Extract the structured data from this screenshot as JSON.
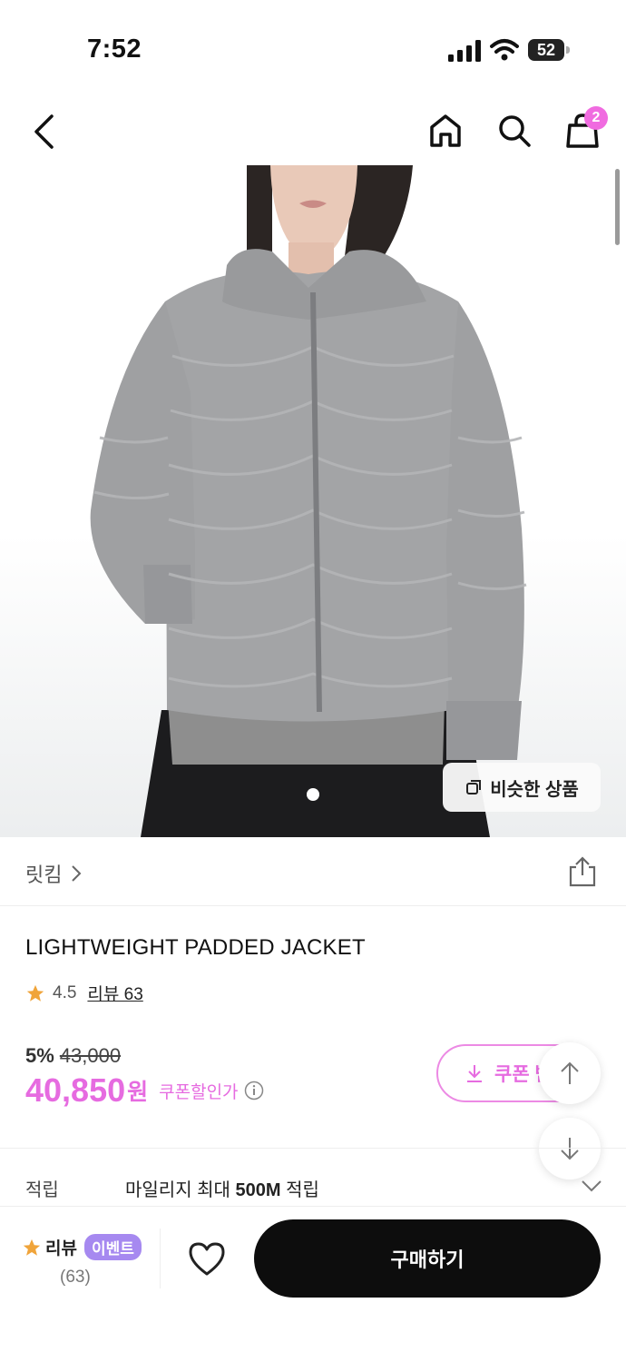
{
  "status_bar": {
    "time": "7:52",
    "battery": "52"
  },
  "header": {
    "cart_count": "2"
  },
  "product": {
    "similar_button": "비슷한 상품",
    "brand": "릿킴",
    "title": "LIGHTWEIGHT PADDED JACKET",
    "rating": "4.5",
    "review_link": "리뷰 63",
    "discount_rate": "5%",
    "original_price": "43,000",
    "sale_price": "40,850",
    "currency": "원",
    "coupon_discount": "쿠폰할인가",
    "coupon_button": "쿠폰 받기"
  },
  "points": {
    "label": "적립",
    "text_pre": "마일리지 최대 ",
    "text_bold": "500M",
    "text_post": " 적립"
  },
  "bottom_bar": {
    "review_label": "리뷰",
    "event_badge": "이벤트",
    "review_count": "(63)",
    "buy_button": "구매하기"
  },
  "colors": {
    "accent": "#e66be0",
    "badge": "#f06be0",
    "event": "#a689f0",
    "buy": "#0d0d0d"
  },
  "icons": [
    "back-icon",
    "home-icon",
    "search-icon",
    "cart-icon",
    "share-icon",
    "star-icon",
    "info-icon",
    "download-icon",
    "arrow-up-icon",
    "arrow-down-icon",
    "chevron-down-icon",
    "heart-icon",
    "copy-icon",
    "chevron-right-icon"
  ]
}
